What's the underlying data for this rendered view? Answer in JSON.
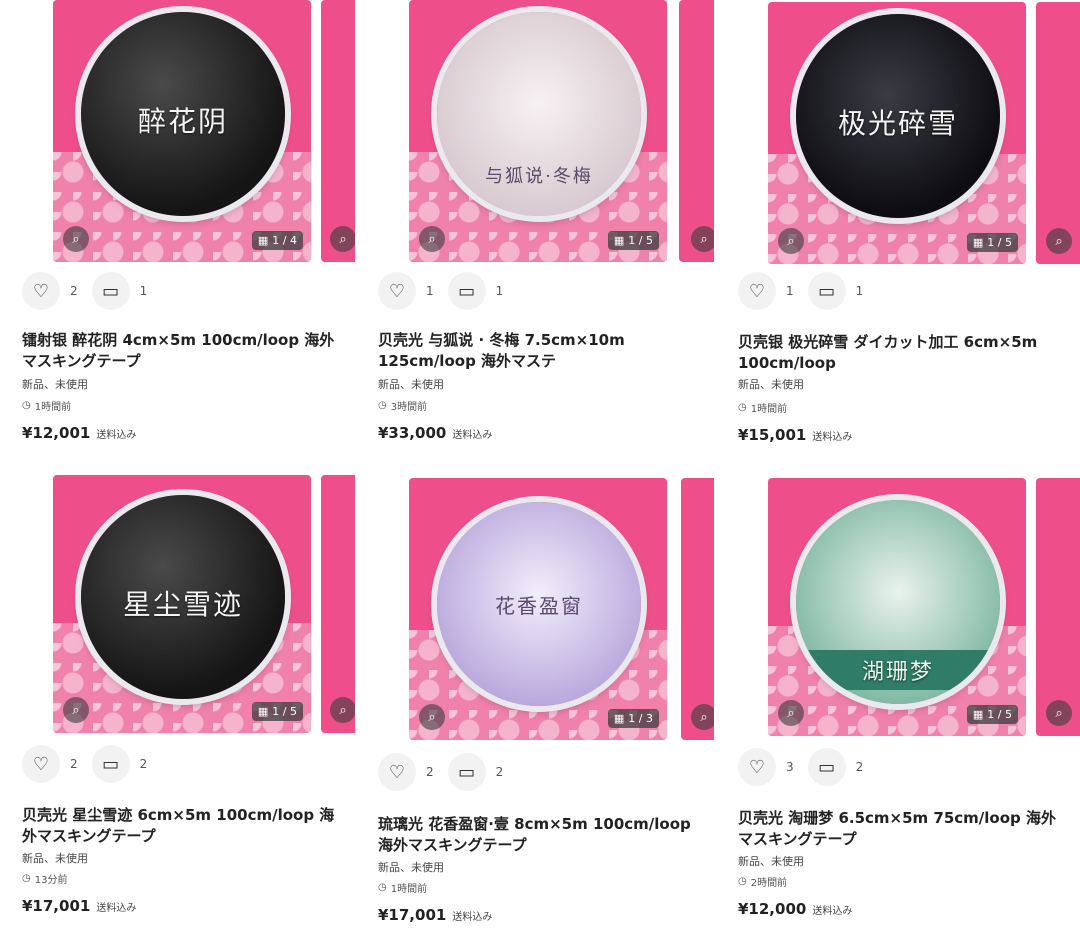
{
  "products": [
    {
      "image_text": "醉花阴",
      "image_style": "dark",
      "count_badge": "1 / 4",
      "likes": "2",
      "comments": "1",
      "title": "镭射银 醉花阴 4cm×5m 100cm/loop 海外マスキングテープ",
      "condition": "新品、未使用",
      "time": "1時間前",
      "price": "¥12,001",
      "shipping": "送料込み"
    },
    {
      "image_text": "与狐说·冬梅",
      "image_style": "light",
      "count_badge": "1 / 5",
      "likes": "1",
      "comments": "1",
      "title": "贝壳光 与狐说 · 冬梅 7.5cm×10m 125cm/loop 海外マステ",
      "condition": "新品、未使用",
      "time": "3時間前",
      "price": "¥33,000",
      "shipping": "送料込み"
    },
    {
      "image_text": "极光碎雪",
      "image_style": "snow",
      "count_badge": "1 / 5",
      "likes": "1",
      "comments": "1",
      "title": "贝壳银 极光碎雪 ダイカット加工 6cm×5m 100cm/loop",
      "condition": "新品、未使用",
      "time": "1時間前",
      "price": "¥15,001",
      "shipping": "送料込み"
    },
    {
      "image_text": "星尘雪迹",
      "image_style": "dark",
      "count_badge": "1 / 5",
      "likes": "2",
      "comments": "2",
      "title": "贝壳光 星尘雪迹 6cm×5m 100cm/loop 海外マスキングテープ",
      "condition": "新品、未使用",
      "time": "13分前",
      "price": "¥17,001",
      "shipping": "送料込み"
    },
    {
      "image_text": "花香盈窗",
      "image_style": "purple",
      "count_badge": "1 / 3",
      "likes": "2",
      "comments": "2",
      "title": "琉璃光 花香盈窗·壹 8cm×5m 100cm/loop 海外マスキングテープ",
      "condition": "新品、未使用",
      "time": "1時間前",
      "price": "¥17,001",
      "shipping": "送料込み"
    },
    {
      "image_text": "湖珊梦",
      "image_style": "green",
      "count_badge": "1 / 5",
      "likes": "3",
      "comments": "2",
      "title": "贝壳光 淘珊梦 6.5cm×5m 75cm/loop 海外マスキングテープ",
      "condition": "新品、未使用",
      "time": "2時間前",
      "price": "¥12,000",
      "shipping": "送料込み"
    }
  ]
}
